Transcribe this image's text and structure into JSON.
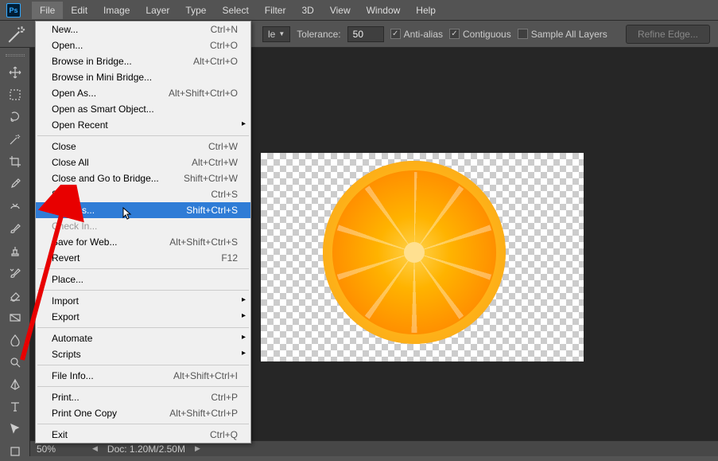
{
  "menubar": [
    "File",
    "Edit",
    "Image",
    "Layer",
    "Type",
    "Select",
    "Filter",
    "3D",
    "View",
    "Window",
    "Help"
  ],
  "activeMenu": 0,
  "optbar": {
    "dropdown_suffix": "le",
    "tolerance_label": "Tolerance:",
    "tolerance_value": "50",
    "antialias": "Anti-alias",
    "contiguous": "Contiguous",
    "sample_all": "Sample All Layers",
    "refine": "Refine Edge..."
  },
  "dropdown": [
    {
      "label": "New...",
      "shortcut": "Ctrl+N"
    },
    {
      "label": "Open...",
      "shortcut": "Ctrl+O"
    },
    {
      "label": "Browse in Bridge...",
      "shortcut": "Alt+Ctrl+O"
    },
    {
      "label": "Browse in Mini Bridge..."
    },
    {
      "label": "Open As...",
      "shortcut": "Alt+Shift+Ctrl+O"
    },
    {
      "label": "Open as Smart Object..."
    },
    {
      "label": "Open Recent",
      "submenu": true
    },
    {
      "sep": true
    },
    {
      "label": "Close",
      "shortcut": "Ctrl+W"
    },
    {
      "label": "Close All",
      "shortcut": "Alt+Ctrl+W"
    },
    {
      "label": "Close and Go to Bridge...",
      "shortcut": "Shift+Ctrl+W"
    },
    {
      "label": "Save",
      "shortcut": "Ctrl+S"
    },
    {
      "label": "Save As...",
      "shortcut": "Shift+Ctrl+S",
      "highlighted": true
    },
    {
      "label": "Check In...",
      "disabled": true
    },
    {
      "label": "Save for Web...",
      "shortcut": "Alt+Shift+Ctrl+S"
    },
    {
      "label": "Revert",
      "shortcut": "F12"
    },
    {
      "sep": true
    },
    {
      "label": "Place..."
    },
    {
      "sep": true
    },
    {
      "label": "Import",
      "submenu": true
    },
    {
      "label": "Export",
      "submenu": true
    },
    {
      "sep": true
    },
    {
      "label": "Automate",
      "submenu": true
    },
    {
      "label": "Scripts",
      "submenu": true
    },
    {
      "sep": true
    },
    {
      "label": "File Info...",
      "shortcut": "Alt+Shift+Ctrl+I"
    },
    {
      "sep": true
    },
    {
      "label": "Print...",
      "shortcut": "Ctrl+P"
    },
    {
      "label": "Print One Copy",
      "shortcut": "Alt+Shift+Ctrl+P"
    },
    {
      "sep": true
    },
    {
      "label": "Exit",
      "shortcut": "Ctrl+Q"
    }
  ],
  "tools": [
    "move-tool",
    "marquee-tool",
    "lasso-tool",
    "magic-wand-tool",
    "crop-tool",
    "eyedropper-tool",
    "healing-brush-tool",
    "brush-tool",
    "clone-stamp-tool",
    "history-brush-tool",
    "eraser-tool",
    "gradient-tool",
    "blur-tool",
    "dodge-tool",
    "pen-tool",
    "type-tool",
    "path-selection-tool",
    "rectangle-tool"
  ],
  "status": {
    "zoom": "50%",
    "doc": "Doc: 1.20M/2.50M"
  }
}
